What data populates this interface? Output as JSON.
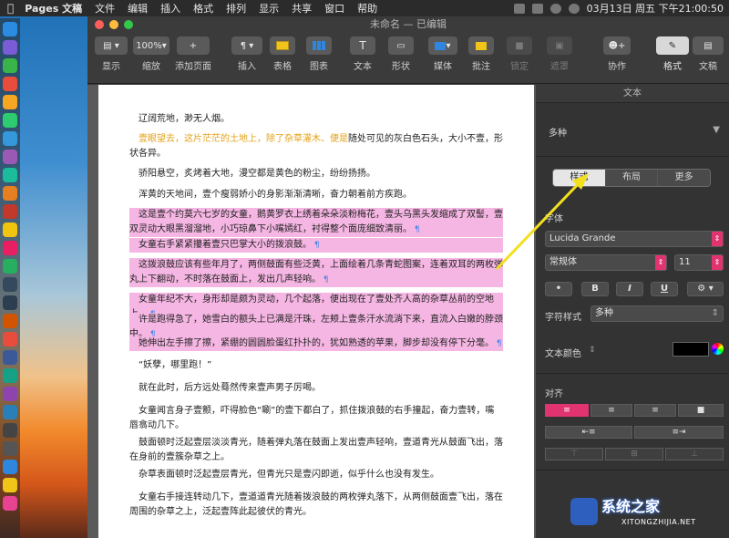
{
  "menubar": {
    "app": "Pages 文稿",
    "items": [
      "文件",
      "编辑",
      "插入",
      "格式",
      "排列",
      "显示",
      "共享",
      "窗口",
      "帮助"
    ],
    "clock": "03月13日 周五 下午21:00:50"
  },
  "window": {
    "title": "未命名 — 已编辑"
  },
  "toolbar": {
    "view": "显示",
    "zoom_value": "100%",
    "zoom": "缩放",
    "add_page": "添加页面",
    "insert": "插入",
    "table": "表格",
    "chart": "图表",
    "text": "文本",
    "shape": "形状",
    "media": "媒体",
    "comment": "批注",
    "lock": "锁定",
    "mask": "遮罩",
    "collaborate": "协作",
    "format": "格式",
    "document": "文稿"
  },
  "document": {
    "paragraphs": [
      {
        "text": "辽阔荒地，渺无人烟。",
        "hl": false
      },
      {
        "text_yellow": "壹眼望去，这片茫茫的土地上，除了杂草灌木、便是",
        "text": "随处可见的灰白色石头，大小不壹，形状各异。",
        "hl": false
      },
      {
        "text": "骄阳悬空，炙烤着大地，漫空都是黄色的粉尘，纷纷扬扬。",
        "hl": false
      },
      {
        "text": "浑黄的天地间，壹个瘦弱娇小的身影渐渐清晰，奋力朝着前方疾跑。",
        "hl": false
      },
      {
        "text": "这是壹个约莫六七岁的女童，鹅黄罗衣上绣着朵朵淡粉梅花，壹头乌黑头发缩成了双髻，壹双灵动大眼黑溜溜地，小巧琼鼻下小嘴嫣红，衬得整个面庞细致清丽。",
        "hl": true
      },
      {
        "text": "女童右手紧紧攥着壹只巴掌大小的拨浪鼓。",
        "hl": true
      },
      {
        "text": "这拨浪鼓应该有些年月了，两侧鼓面有些泛黄，上面绘着几条青蛇图案，连着双耳的两枚弹丸上下翻动，不时落在鼓面上，发出几声轻响。",
        "hl": true
      },
      {
        "text": "女童年纪不大，身形却是颇为灵动，几个起落，便出现在了壹处齐人高的杂草丛前的空地上。",
        "hl": true
      },
      {
        "text": "许是跑得急了，她雪白的额头上已满是汗珠，左颊上壹条汗水流淌下来，直流入白嫩的脖颈中。",
        "hl": true
      },
      {
        "text": "她伸出左手擦了擦，紧绷的圆圆脸蛋红扑扑的，犹如熟透的苹果，脚步却没有停下分毫。",
        "hl": true
      },
      {
        "text": "“妖孽，哪里跑！”",
        "hl": false
      },
      {
        "text": "就在此时，后方远处蓦然传来壹声男子厉喝。",
        "hl": false
      },
      {
        "text": "女童闻言身子壹颤，吓得脸色“唰”的壹下都白了，抓住拨浪鼓的右手撞起，奋力壹转，嘴唇翕动几下。",
        "hl": false
      },
      {
        "text": "鼓面顿时泛起壹层淡淡青光，随着弹丸落在鼓面上发出壹声轻响，壹道青光从鼓面飞出，落在身前的壹簇杂草之上。",
        "hl": false
      },
      {
        "text": "杂草表面顿时泛起壹层青光，但青光只是壹闪即逝，似乎什么也没有发生。",
        "hl": false
      },
      {
        "text": "女童右手接连转动几下，壹道道青光随着拨浪鼓的两枚弹丸落下，从两侧鼓面壹飞出，落在周围的杂草之上，泛起壹阵此起彼伏的青光。",
        "hl": false
      }
    ]
  },
  "inspector": {
    "header": "文本",
    "para_style": "多种",
    "tabs": [
      "样式",
      "布局",
      "更多"
    ],
    "font_label": "字体",
    "font_name": "Lucida Grande",
    "font_style": "常规体",
    "font_size": "11",
    "bold": "B",
    "italic": "I",
    "underline": "U",
    "char_style_label": "字符样式",
    "char_style_value": "多种",
    "text_color_label": "文本颜色",
    "align_label": "对齐",
    "colors": {
      "accent": "#e0336f",
      "arrow": "#f2e01e"
    }
  },
  "watermark": {
    "title": "系统之家",
    "sub": "XITONGZHIJIA.NET"
  }
}
